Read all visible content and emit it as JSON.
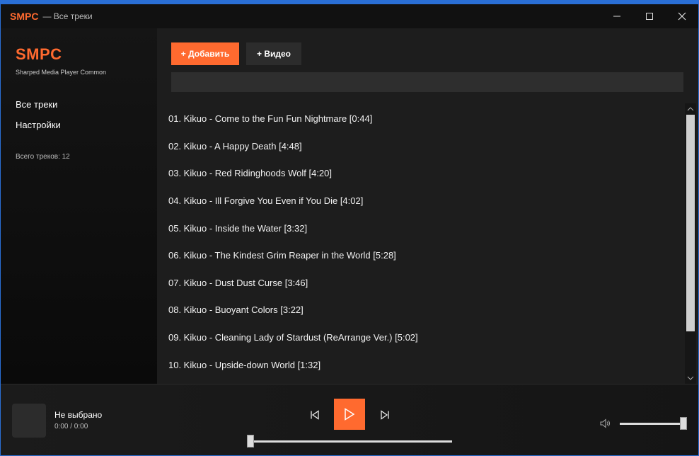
{
  "titlebar": {
    "app": "SMPC",
    "subtitle": "— Все треки",
    "icons": [
      "minimize-icon",
      "maximize-icon",
      "close-icon"
    ]
  },
  "sidebar": {
    "brand": "SMPC",
    "brand_subtitle": "Sharped Media Player Common",
    "nav": [
      {
        "label": "Все треки"
      },
      {
        "label": "Настройки"
      }
    ],
    "track_count": "Всего треков: 12"
  },
  "toolbar": {
    "add_label": "+ Добавить",
    "video_label": "+ Видео"
  },
  "search": {
    "value": "",
    "placeholder": ""
  },
  "tracks": [
    {
      "label": "01. Kikuo - Come to the Fun Fun Nightmare  [0:44]"
    },
    {
      "label": "02. Kikuo - A Happy Death  [4:48]"
    },
    {
      "label": "03. Kikuo - Red Ridinghoods Wolf  [4:20]"
    },
    {
      "label": "04. Kikuo - Ill Forgive You Even if You Die  [4:02]"
    },
    {
      "label": "05. Kikuo - Inside the Water  [3:32]"
    },
    {
      "label": "06. Kikuo - The Kindest Grim Reaper in the World  [5:28]"
    },
    {
      "label": "07. Kikuo - Dust Dust Curse  [3:46]"
    },
    {
      "label": "08. Kikuo - Buoyant Colors  [3:22]"
    },
    {
      "label": "09. Kikuo - Cleaning Lady of Stardust (ReArrange Ver.)  [5:02]"
    },
    {
      "label": "10. Kikuo - Upside-down World  [1:32]"
    }
  ],
  "player": {
    "title": "Не выбрано",
    "time": "0:00 / 0:00",
    "progress": 0,
    "volume": 1.0,
    "icons": [
      "prev-icon",
      "play-icon",
      "next-icon",
      "volume-icon"
    ]
  },
  "colors": {
    "accent": "#ff6a2f",
    "window_border": "#2a6fd6"
  }
}
